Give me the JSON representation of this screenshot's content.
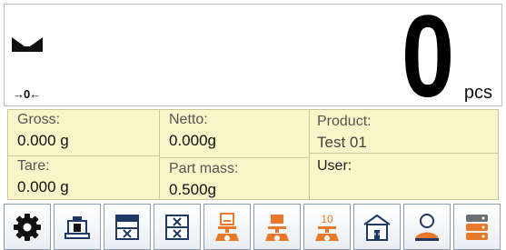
{
  "display": {
    "stability_icon": "stable-marker-icon",
    "zero_indicator": "→0←",
    "value": "0",
    "unit": "pcs"
  },
  "fields": {
    "gross": {
      "label": "Gross:",
      "value": "0.000 g"
    },
    "netto": {
      "label": "Netto:",
      "value": "0.000g"
    },
    "product": {
      "label": "Product:",
      "value": "Test 01"
    },
    "tare": {
      "label": "Tare:",
      "value": "0.000 g"
    },
    "part_mass": {
      "label": "Part mass:",
      "value": "0.500g"
    },
    "user": {
      "label": "User:",
      "value": ""
    }
  },
  "toolbar": {
    "buttons": [
      {
        "name": "settings-button",
        "icon": "gear-icon"
      },
      {
        "name": "tare-button",
        "icon": "scale-weight-icon"
      },
      {
        "name": "set-part-mass-button",
        "icon": "part-mass-icon"
      },
      {
        "name": "part-mass-list-button",
        "icon": "part-mass-list-icon"
      },
      {
        "name": "sample-on-pan-button",
        "icon": "scale-sample-icon"
      },
      {
        "name": "weigh-reference-button",
        "icon": "scale-reference-icon"
      },
      {
        "name": "reference-10-button",
        "icon": "scale-10-icon"
      },
      {
        "name": "product-database-button",
        "icon": "product-box-icon"
      },
      {
        "name": "user-button",
        "icon": "user-icon"
      },
      {
        "name": "database-button",
        "icon": "database-icon"
      }
    ],
    "reference_count": "10"
  },
  "colors": {
    "info_background": "#faf4c9",
    "accent_orange": "#e8782a",
    "icon_navy": "#1f3864"
  }
}
